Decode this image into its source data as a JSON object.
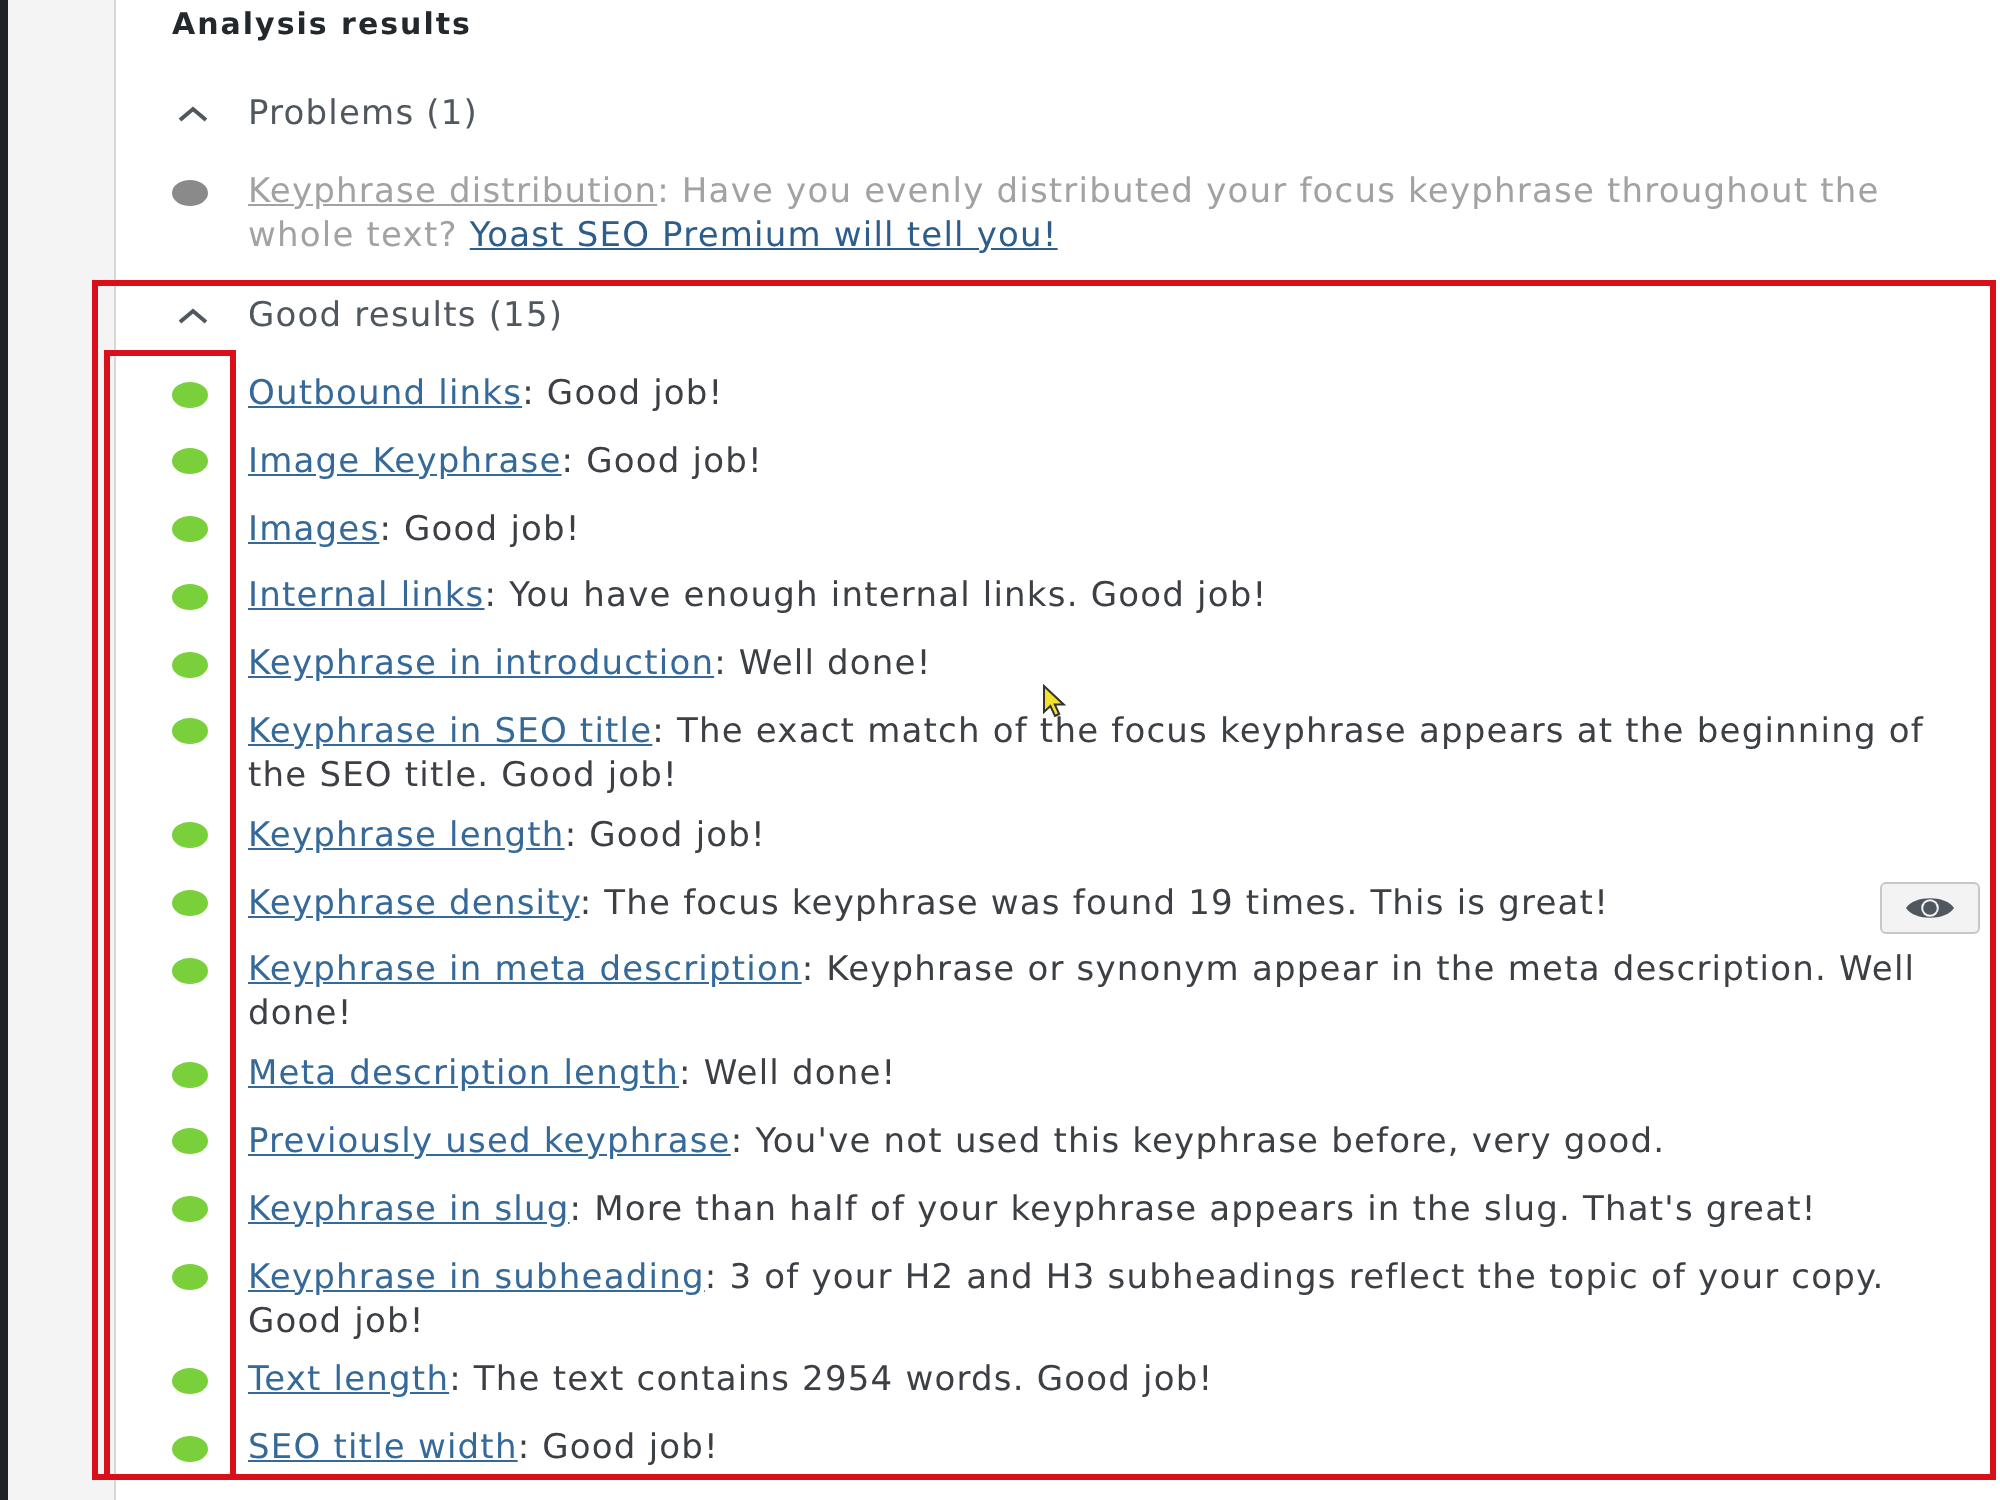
{
  "panel": {
    "title": "Analysis results"
  },
  "sections": [
    {
      "title": "Problems (1)",
      "expanded": true,
      "highlighted": false,
      "markers_highlighted": false,
      "items": [
        {
          "link": "Keyphrase distribution",
          "text": ": Have you evenly distributed your focus keyphrase throughout the whole text?",
          "upsell_link": "Yoast SEO Premium will tell you!",
          "color": "#8a8a8a",
          "disabled": true,
          "eye_button": false
        }
      ]
    },
    {
      "title": "Good results (15)",
      "expanded": true,
      "highlighted": true,
      "markers_highlighted": true,
      "items": [
        {
          "link": "Outbound links",
          "text": ": Good job!",
          "color": "#7ad03a",
          "disabled": false,
          "eye_button": false
        },
        {
          "link": "Image Keyphrase",
          "text": ": Good job!",
          "color": "#7ad03a",
          "disabled": false,
          "eye_button": false
        },
        {
          "link": "Images",
          "text": ": Good job!",
          "color": "#7ad03a",
          "disabled": false,
          "eye_button": false
        },
        {
          "link": "Internal links",
          "text": ": You have enough internal links. Good job!",
          "color": "#7ad03a",
          "disabled": false,
          "eye_button": false
        },
        {
          "link": "Keyphrase in introduction",
          "text": ": Well done!",
          "color": "#7ad03a",
          "disabled": false,
          "eye_button": false
        },
        {
          "link": "Keyphrase in SEO title",
          "text": ": The exact match of the focus keyphrase appears at the beginning of the SEO title. Good job!",
          "color": "#7ad03a",
          "disabled": false,
          "eye_button": false
        },
        {
          "link": "Keyphrase length",
          "text": ": Good job!",
          "color": "#7ad03a",
          "disabled": false,
          "eye_button": false
        },
        {
          "link": "Keyphrase density",
          "text": ": The focus keyphrase was found 19 times. This is great!",
          "color": "#7ad03a",
          "disabled": false,
          "eye_button": true
        },
        {
          "link": "Keyphrase in meta description",
          "text": ": Keyphrase or synonym appear in the meta description. Well done!",
          "color": "#7ad03a",
          "disabled": false,
          "eye_button": false
        },
        {
          "link": "Meta description length",
          "text": ": Well done!",
          "color": "#7ad03a",
          "disabled": false,
          "eye_button": false
        },
        {
          "link": "Previously used keyphrase",
          "text": ": You've not used this keyphrase before, very good.",
          "color": "#7ad03a",
          "disabled": false,
          "eye_button": false
        },
        {
          "link": "Keyphrase in slug",
          "text": ": More than half of your keyphrase appears in the slug. That's great!",
          "color": "#7ad03a",
          "disabled": false,
          "eye_button": false
        },
        {
          "link": "Keyphrase in subheading",
          "text": ": 3 of your H2 and H3 subheadings reflect the topic of your copy. Good job!",
          "color": "#7ad03a",
          "disabled": false,
          "eye_button": false
        },
        {
          "link": "Text length",
          "text": ": The text contains 2954 words. Good job!",
          "color": "#7ad03a",
          "disabled": false,
          "eye_button": false
        },
        {
          "link": "SEO title width",
          "text": ": Good job!",
          "color": "#7ad03a",
          "disabled": false,
          "eye_button": false
        }
      ]
    }
  ]
}
